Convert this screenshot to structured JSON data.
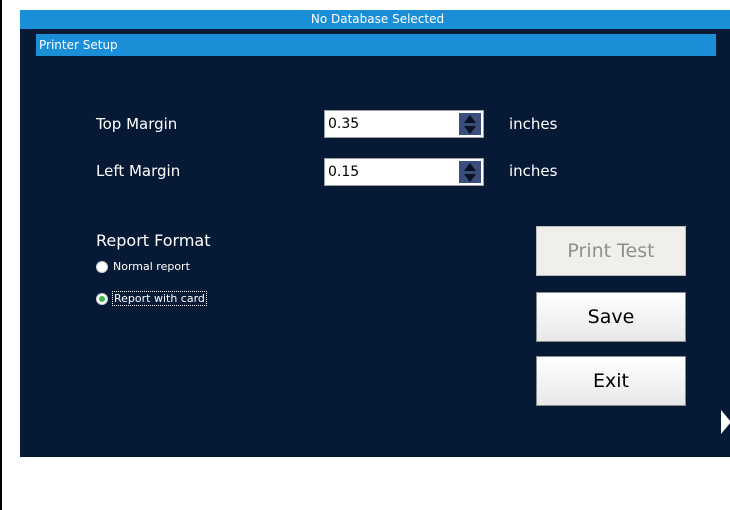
{
  "window": {
    "title": "No Database Selected"
  },
  "section": {
    "title": "Printer Setup"
  },
  "margins": {
    "top": {
      "label": "Top Margin",
      "value": "0.35",
      "unit": "inches"
    },
    "left": {
      "label": "Left Margin",
      "value": "0.15",
      "unit": "inches"
    }
  },
  "report_format": {
    "label": "Report Format",
    "options": [
      {
        "label": "Normal report",
        "selected": false
      },
      {
        "label": "Report with card",
        "selected": true
      }
    ]
  },
  "buttons": {
    "print_test": "Print Test",
    "save": "Save",
    "exit": "Exit"
  },
  "colors": {
    "background": "#071a35",
    "accent": "#1a8fd8",
    "selected_radio": "#39b54a"
  },
  "icons": {
    "spinner_up": "triangle-up-icon",
    "spinner_down": "triangle-down-icon",
    "next": "chevron-right-icon"
  }
}
